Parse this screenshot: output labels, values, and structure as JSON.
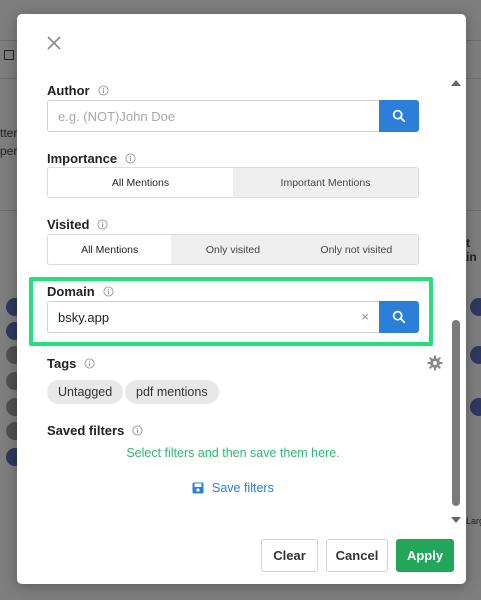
{
  "background": {
    "fragments": [
      "tter",
      "per",
      "t in",
      "Larg"
    ]
  },
  "modal": {
    "author": {
      "label": "Author",
      "placeholder": "e.g. (NOT)John Doe",
      "value": ""
    },
    "importance": {
      "label": "Importance",
      "options": [
        "All Mentions",
        "Important Mentions"
      ],
      "selected": "All Mentions"
    },
    "visited": {
      "label": "Visited",
      "options": [
        "All Mentions",
        "Only visited",
        "Only not visited"
      ],
      "selected": "All Mentions"
    },
    "domain": {
      "label": "Domain",
      "value": "bsky.app",
      "clear": "×"
    },
    "tags": {
      "label": "Tags",
      "items": [
        "Untagged",
        "pdf mentions"
      ]
    },
    "saved_filters": {
      "label": "Saved filters",
      "empty_text": "Select filters and then save them here.",
      "save_label": "Save filters"
    },
    "footer": {
      "clear": "Clear",
      "cancel": "Cancel",
      "apply": "Apply"
    }
  },
  "colors": {
    "accent_blue": "#2b7fd8",
    "apply_green": "#21a65a",
    "highlight_green": "#22e07a",
    "empty_text_green": "#2eb872"
  },
  "icons": [
    "close-icon",
    "info-icon",
    "search-icon",
    "gear-icon",
    "save-icon"
  ]
}
